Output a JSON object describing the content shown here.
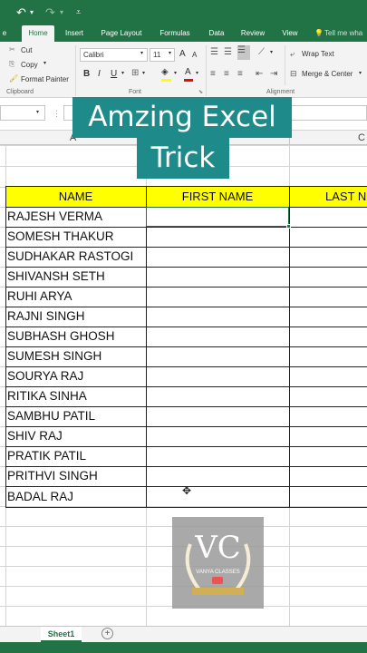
{
  "quick_access": {
    "undo_icon": "undo-icon",
    "redo_icon": "redo-icon",
    "customize_icon": "customize-icon"
  },
  "tabs": [
    {
      "label": "e"
    },
    {
      "label": "Home",
      "active": true
    },
    {
      "label": "Insert"
    },
    {
      "label": "Page Layout"
    },
    {
      "label": "Formulas"
    },
    {
      "label": "Data"
    },
    {
      "label": "Review"
    },
    {
      "label": "View"
    },
    {
      "label": "Tell me wha"
    }
  ],
  "ribbon": {
    "cut": "Cut",
    "copy": "Copy",
    "format_painter": "Format Painter",
    "clipboard_group": "Clipboard",
    "font_name": "Calibri",
    "font_size": "11",
    "bold": "B",
    "italic": "I",
    "underline": "U",
    "grow_font": "A",
    "shrink_font": "A",
    "font_group": "Font",
    "wrap_text": "Wrap Text",
    "merge_center": "Merge & Center",
    "alignment_group": "Alignment",
    "highlight_color": "#ffff00",
    "font_color": "#ff0000"
  },
  "formula_bar": {
    "name_box": "",
    "formula": ""
  },
  "columns": {
    "a": "A",
    "c": "C"
  },
  "overlay_title": {
    "line1": "Amzing Excel",
    "line2": "Trick"
  },
  "table": {
    "headers": [
      "NAME",
      "FIRST NAME",
      "LAST N"
    ],
    "names": [
      "RAJESH VERMA",
      "SOMESH THAKUR",
      "SUDHAKAR RASTOGI",
      "SHIVANSH SETH",
      "RUHI ARYA",
      "RAJNI SINGH",
      "SUBHASH GHOSH",
      "SUMESH SINGH",
      "SOURYA RAJ",
      "RITIKA SINHA",
      "SAMBHU PATIL",
      "SHIV RAJ",
      "PRATIK PATIL",
      "PRITHVI SINGH",
      "BADAL RAJ"
    ]
  },
  "watermark": {
    "initials": "VC",
    "text": "VANYA CLASSES"
  },
  "sheets": {
    "active": "Sheet1",
    "add_icon": "plus-icon"
  },
  "colors": {
    "excel_green": "#217346",
    "title_teal": "#1e8a8a",
    "header_fill": "#ffff00"
  }
}
